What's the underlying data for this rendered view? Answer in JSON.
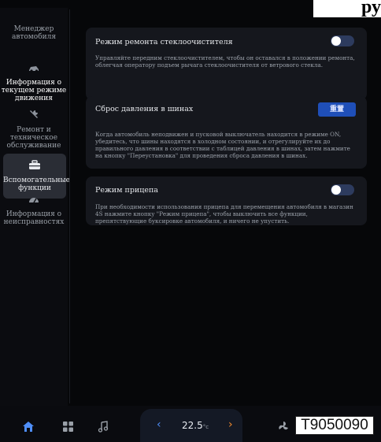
{
  "corner_text": "ру",
  "sidebar": {
    "items": [
      {
        "label": "Менеджер автомобиля",
        "icon": "car-manager-icon"
      },
      {
        "label": "Информация о текущем режиме движения",
        "icon": "car-drive-icon"
      },
      {
        "label": "Ремонт и техническое обслуживание",
        "icon": "wrench-icon"
      },
      {
        "label": "Вспомогательные функции",
        "icon": "toolbox-icon"
      },
      {
        "label": "Информация о неисправностях",
        "icon": "fault-gauge-icon"
      }
    ]
  },
  "cards": {
    "wiper": {
      "title": "Режим ремонта стеклоочистителя",
      "desc": "Управляйте передним стеклоочистителем, чтобы он оставался в положении ремонта, облегчая оператору подъем рычага стеклоочистителя от ветрового стекла.",
      "toggle_on": false
    },
    "tire": {
      "title": "Сброс давления в шинах",
      "button_label": "重置",
      "desc": "Когда автомобиль неподвижен и пусковой выключатель находится в режиме ON, убедитесь, что шины находятся в холодном состоянии, и отрегулируйте их до правильного давления в соответствии с таблицей давления в шинах, затем нажмите на кнопку \"Переустановка\" для проведения сброса давления в шинах."
    },
    "trailer": {
      "title": "Режим прицепа",
      "desc": "При необходимости использования прицепа для перемещения автомобиля в магазин 4S нажмите кнопку \"Режим прицепа\", чтобы выключить все функции, препятствующие буксировке автомобиля, и ничего не упустить.",
      "toggle_on": false
    }
  },
  "bottombar": {
    "temperature": "22.5",
    "unit": "°c",
    "code": "T9050090"
  },
  "colors": {
    "accent": "#1f4fb8",
    "background": "#060709",
    "card": "#15171d"
  }
}
